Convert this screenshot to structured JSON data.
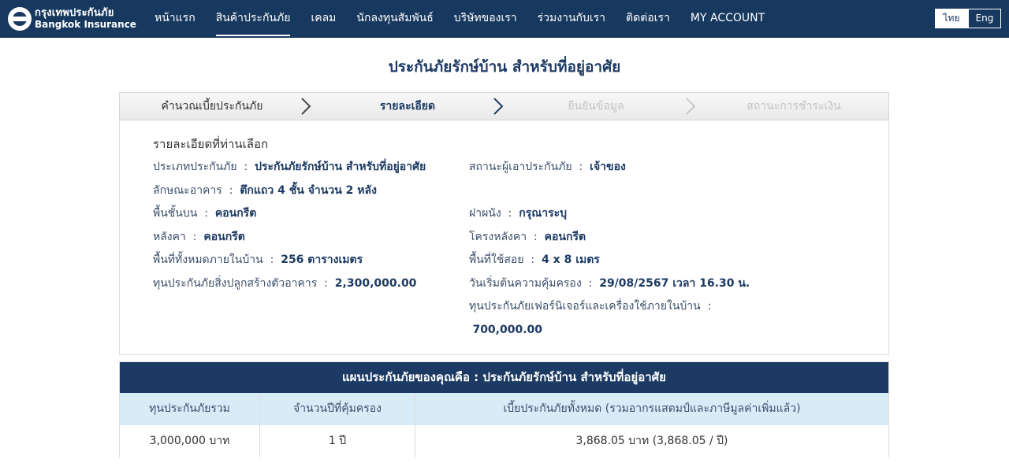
{
  "brand": {
    "logo_th": "กรุงเทพประกันภัย",
    "logo_en": "Bangkok Insurance",
    "icon": "bki-logo-icon"
  },
  "nav": {
    "items": [
      {
        "label": "หน้าแรก",
        "active": false
      },
      {
        "label": "สินค้าประกันภัย",
        "active": true
      },
      {
        "label": "เคลม",
        "active": false
      },
      {
        "label": "นักลงทุนสัมพันธ์",
        "active": false
      },
      {
        "label": "บริษัทของเรา",
        "active": false
      },
      {
        "label": "ร่วมงานกับเรา",
        "active": false
      },
      {
        "label": "ติดต่อเรา",
        "active": false
      },
      {
        "label": "MY ACCOUNT",
        "active": false
      }
    ],
    "lang_th": "ไทย",
    "lang_en": "Eng"
  },
  "page": {
    "title": "ประกันภัยรักษ์บ้าน สำหรับที่อยู่อาศัย"
  },
  "steps": [
    {
      "label": "คำนวณเบี้ยประกันภัย",
      "state": "done"
    },
    {
      "label": "รายละเอียด",
      "state": "active"
    },
    {
      "label": "ยืนยันข้อมูล",
      "state": "todo"
    },
    {
      "label": "สถานะการชำระเงิน",
      "state": "todo"
    }
  ],
  "details": {
    "heading": "รายละเอียดที่ท่านเลือก",
    "left": [
      {
        "label": "ประเภทประกันภัย",
        "value": "ประกันภัยรักษ์บ้าน สำหรับที่อยู่อาศัย"
      },
      {
        "label": "ลักษณะอาคาร",
        "value": "ตึกแถว 4 ชั้น จำนวน 2 หลัง"
      },
      {
        "label": "พื้นชั้นบน",
        "value": "คอนกรีต"
      },
      {
        "label": "หลังคา",
        "value": "คอนกรีต"
      },
      {
        "label": "พื้นที่ทั้งหมดภายในบ้าน",
        "value": "256 ตารางเมตร"
      },
      {
        "label": "ทุนประกันภัยสิ่งปลูกสร้างตัวอาคาร",
        "value": "2,300,000.00"
      }
    ],
    "right": [
      {
        "label": "สถานะผู้เอาประกันภัย",
        "value": "เจ้าของ"
      },
      {
        "label": "ฝาผนัง",
        "value": "กรุณาระบุ"
      },
      {
        "label": "โครงหลังคา",
        "value": "คอนกรีต"
      },
      {
        "label": "พื้นที่ใช้สอย",
        "value": "4 x 8 เมตร"
      },
      {
        "label": "วันเริ่มต้นความคุ้มครอง",
        "value": "29/08/2567 เวลา 16.30 น."
      },
      {
        "label": "ทุนประกันภัยเฟอร์นิเจอร์และเครื่องใช้ภายในบ้าน",
        "value": "700,000.00"
      }
    ]
  },
  "plan": {
    "title": "แผนประกันภัยของคุณคือ : ประกันภัยรักษ์บ้าน สำหรับที่อยู่อาศัย",
    "headers": [
      "ทุนประกันภัยรวม",
      "จำนวนปีที่คุ้มครอง",
      "เบี้ยประกันภัยทั้งหมด (รวมอากรแสตมป์และภาษีมูลค่าเพิ่มแล้ว)"
    ],
    "row": [
      "3,000,000 บาท",
      "1 ปี",
      "3,868.05 บาท (3,868.05 / ปี)"
    ]
  },
  "colors": {
    "navy": "#18395f",
    "table_header": "#d8ecf8"
  }
}
